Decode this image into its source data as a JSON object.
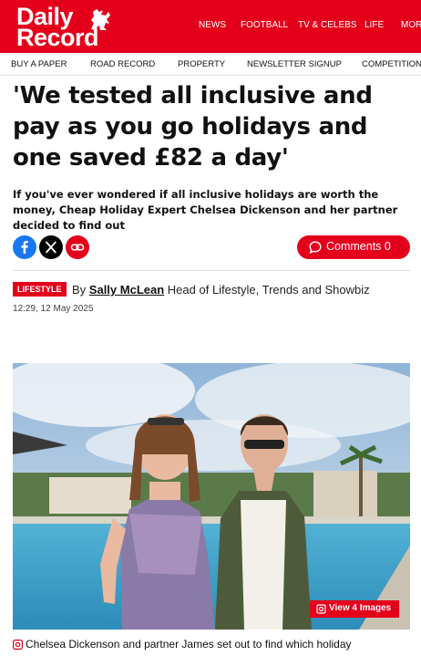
{
  "header": {
    "logo_line1": "Daily",
    "logo_line2": "Record",
    "nav": [
      "NEWS",
      "FOOTBALL",
      "TV & CELEBS",
      "LIFE",
      "MOR"
    ]
  },
  "subnav": [
    "BUY A PAPER",
    "ROAD RECORD",
    "PROPERTY",
    "NEWSLETTER SIGNUP",
    "COMPETITIONS"
  ],
  "article": {
    "headline": "'We tested all inclusive and pay as you go holidays and one saved £82 a day'",
    "standfirst": "If you've ever wondered if all inclusive holidays are worth the money, Cheap Holiday Expert Chelsea Dickenson and her partner decided to find out",
    "comments_label": "Comments 0",
    "category": "LIFESTYLE",
    "by": "By",
    "author": "Sally McLean",
    "author_role": "Head of Lifestyle, Trends and Showbiz",
    "date": "12:29, 12 May 2025",
    "view_images_label": "View 4 Images",
    "caption": "Chelsea Dickenson and partner James set out to find which holiday"
  },
  "icons": {
    "facebook": "facebook-icon",
    "x": "x-icon",
    "link": "link-icon",
    "comment": "comment-icon",
    "gallery": "gallery-icon",
    "logo_mark": "lion-rampant-icon"
  },
  "colors": {
    "brand_red": "#e4001b",
    "facebook_blue": "#1877f2",
    "x_black": "#000000",
    "text": "#111111"
  }
}
